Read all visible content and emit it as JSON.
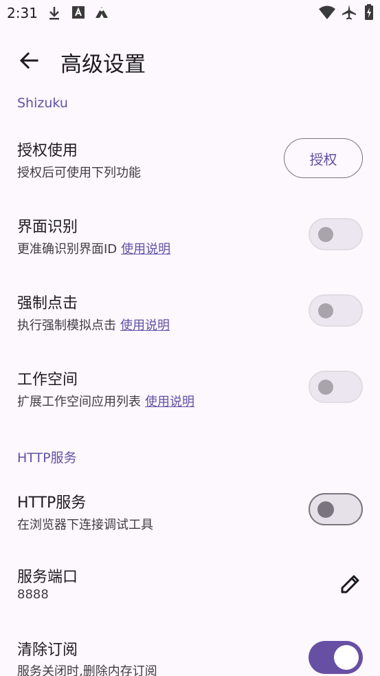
{
  "status_bar": {
    "time": "2:31",
    "left_icons": [
      "download-icon",
      "font-a-icon",
      "tent-icon"
    ],
    "right_icons": [
      "wifi-icon",
      "airplane-icon",
      "battery-charging-icon"
    ]
  },
  "app_bar": {
    "back_icon": "arrow-back-icon",
    "title": "高级设置"
  },
  "sections": {
    "shizuku": {
      "header": "Shizuku",
      "authorize": {
        "title": "授权使用",
        "subtitle": "授权后可使用下列功能",
        "button_label": "授权"
      },
      "ui_recognition": {
        "title": "界面识别",
        "subtitle": "更准确识别界面ID",
        "link": "使用说明",
        "enabled": false
      },
      "force_click": {
        "title": "强制点击",
        "subtitle": "执行强制模拟点击",
        "link": "使用说明",
        "enabled": false
      },
      "workspace": {
        "title": "工作空间",
        "subtitle": "扩展工作空间应用列表",
        "link": "使用说明",
        "enabled": false
      }
    },
    "http": {
      "header": "HTTP服务",
      "http_service": {
        "title": "HTTP服务",
        "subtitle": "在浏览器下连接调试工具",
        "enabled": false
      },
      "service_port": {
        "title": "服务端口",
        "value": "8888",
        "edit_icon": "pencil-icon"
      },
      "clear_subscriptions": {
        "title": "清除订阅",
        "subtitle": "服务关闭时,删除内存订阅",
        "enabled": true
      }
    }
  },
  "colors": {
    "background": "#fdf7fe",
    "accent": "#6750a4",
    "section_header": "#5f52a3",
    "text_primary": "#1c1b1f",
    "text_secondary": "#3f3c44"
  }
}
